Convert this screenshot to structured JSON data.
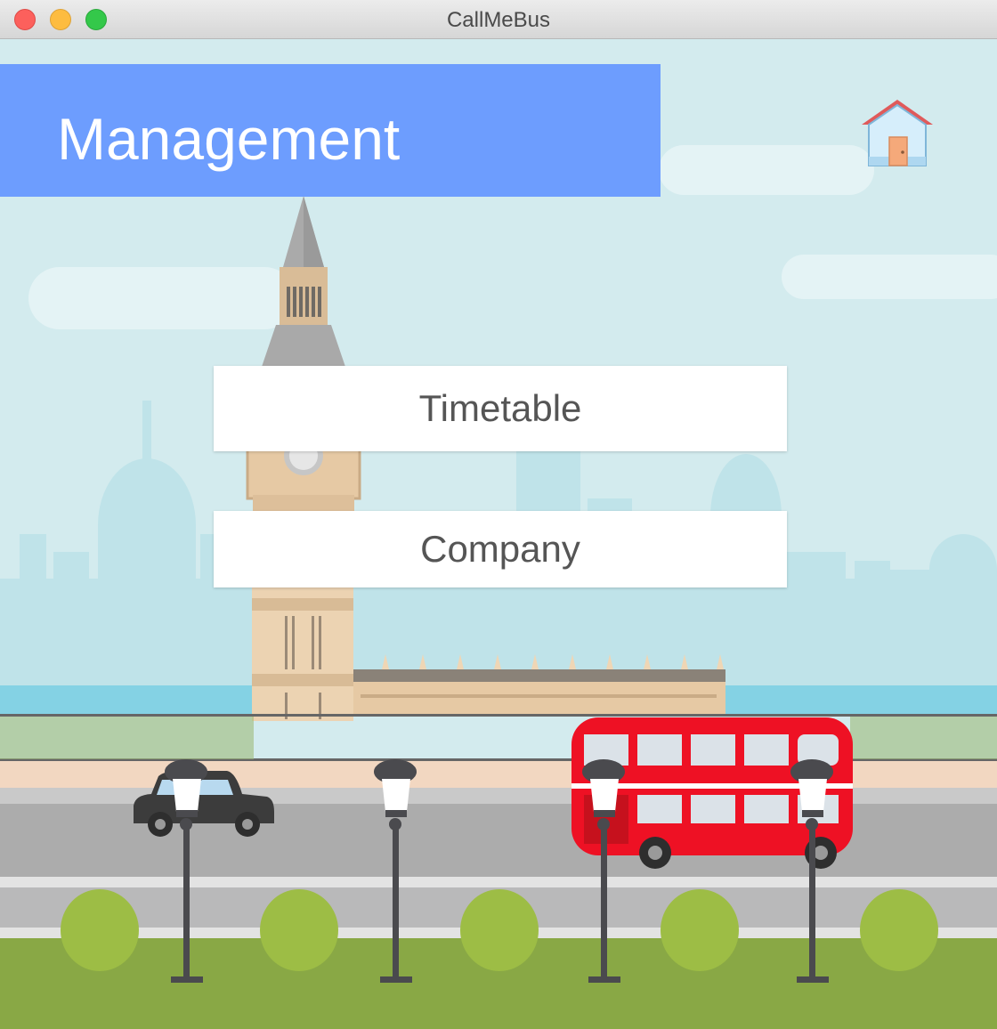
{
  "window": {
    "title": "CallMeBus"
  },
  "header": {
    "title": "Management",
    "home_icon": "home-icon"
  },
  "menu": {
    "timetable_label": "Timetable",
    "company_label": "Company"
  },
  "colors": {
    "header_bg": "#6d9dfe",
    "sky": "#d3ebee",
    "bus_red": "#ee1124",
    "grass": "#89a845",
    "bush": "#9dbd45"
  }
}
